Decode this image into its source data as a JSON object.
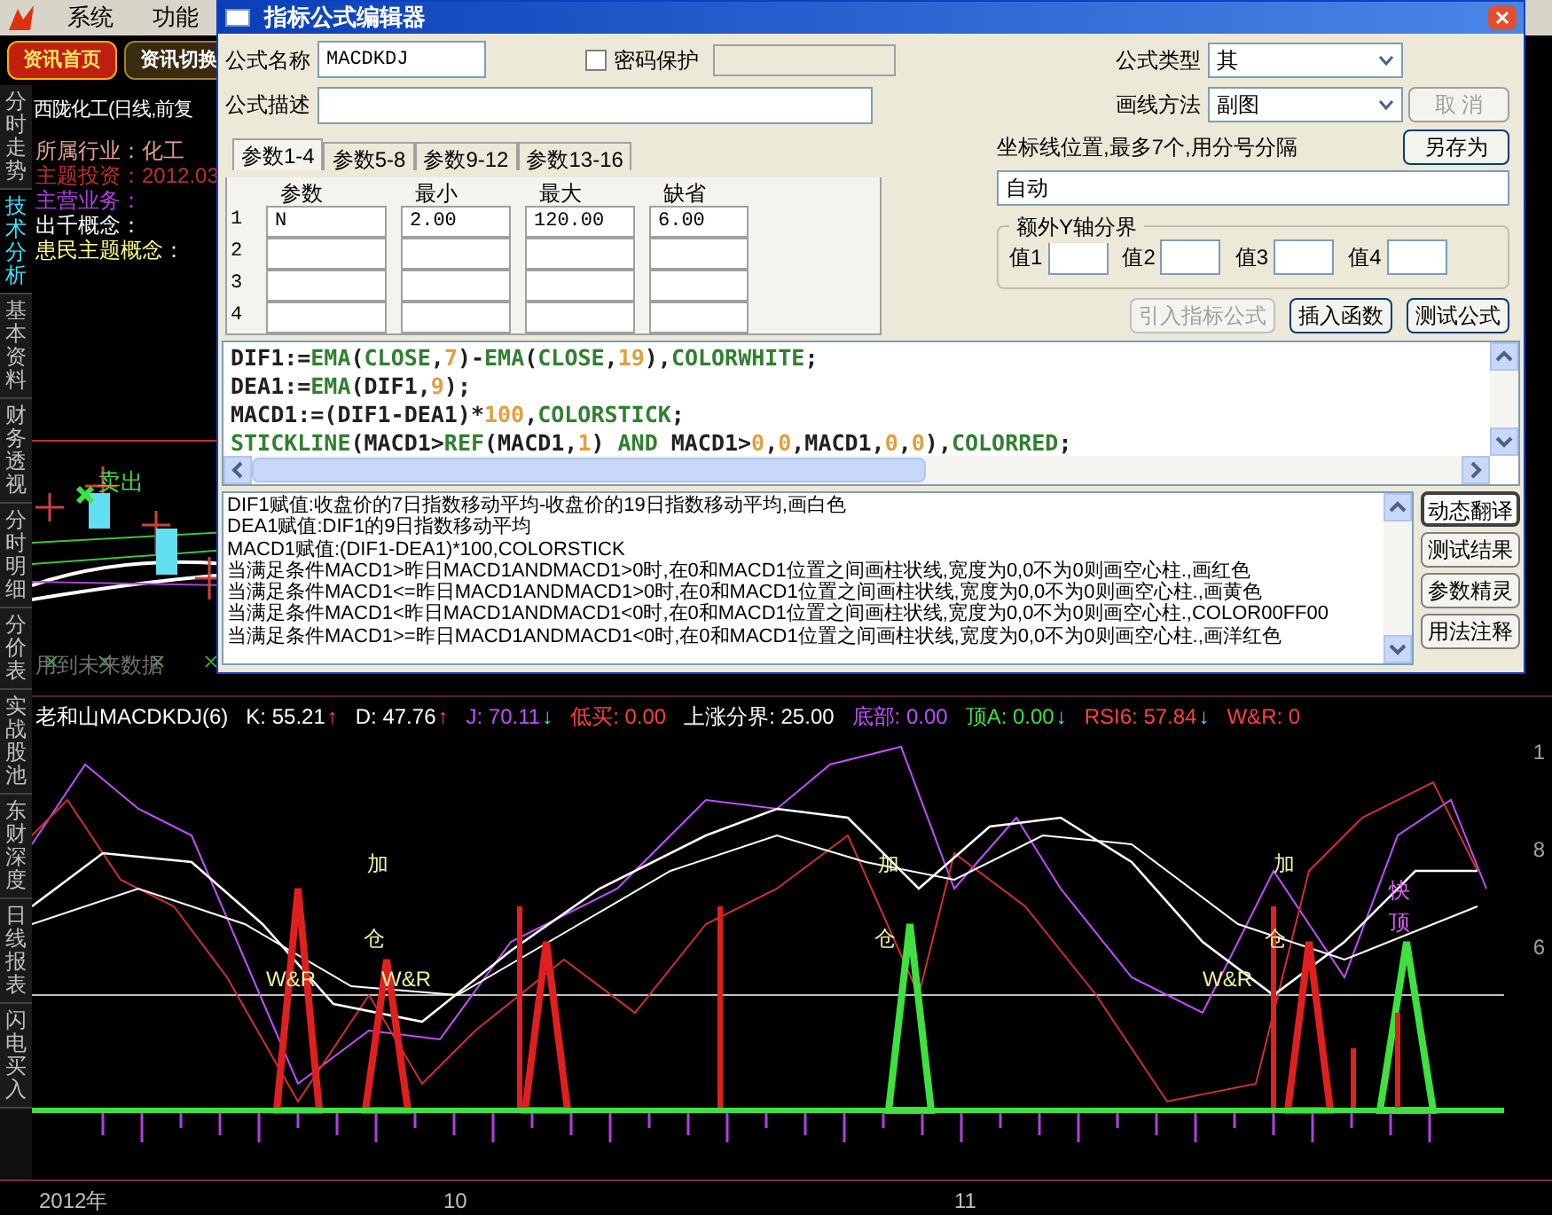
{
  "menu": {
    "items": [
      "系统",
      "功能"
    ]
  },
  "toolbar": [
    {
      "label": "资讯首页",
      "selected": true
    },
    {
      "label": "资讯切换",
      "selected": false
    }
  ],
  "side_tabs": [
    {
      "label": "分时走势",
      "selected": false
    },
    {
      "label": "技术分析",
      "selected": true
    },
    {
      "label": "基本资料",
      "selected": false
    },
    {
      "label": "财务透视",
      "selected": false
    },
    {
      "label": "分时明细",
      "selected": false
    },
    {
      "label": "分价表",
      "selected": false
    },
    {
      "label": "实战股池",
      "selected": false
    },
    {
      "label": "东财深度",
      "selected": false
    },
    {
      "label": "日线报表",
      "selected": false
    },
    {
      "label": "闪电买入",
      "selected": false
    }
  ],
  "stock": {
    "title": "西陇化工(日线,前复",
    "info": [
      {
        "text": "所属行业：化工",
        "color": "#e0a090"
      },
      {
        "text": "主题投资：2012.03",
        "color": "#c03030"
      },
      {
        "text": "主营业务：",
        "color": "#b040e0"
      },
      {
        "text": "出千概念：",
        "color": "#ffffff"
      },
      {
        "text": "患民主题概念：",
        "color": "#ffff80"
      }
    ]
  },
  "upper_chart": {
    "signal": "卖出",
    "note": "用到未来数据"
  },
  "indicator": {
    "name": "老和山MACDKDJ(6)",
    "values": [
      {
        "text": "K: 55.21",
        "color": "#ffffff",
        "kind": "rising",
        "arrow": "↑"
      },
      {
        "text": "D: 47.76",
        "color": "#ffffff",
        "kind": "rising",
        "arrow": "↑"
      },
      {
        "text": "J: 70.11",
        "color": "#c050ff",
        "kind": "falling",
        "arrow": "↓"
      },
      {
        "text": "低买: 0.00",
        "color": "#ff4040",
        "kind": "plain"
      },
      {
        "text": "上涨分界: 25.00",
        "color": "#ffffff",
        "kind": "plain"
      },
      {
        "text": "底部: 0.00",
        "color": "#c050ff",
        "kind": "plain"
      },
      {
        "text": "顶A: 0.00",
        "color": "#40e040",
        "kind": "falling",
        "arrow": "↓"
      },
      {
        "text": "RSI6: 57.84",
        "color": "#ff4040",
        "kind": "falling",
        "arrow": "↓"
      },
      {
        "text": "W&R: 0",
        "color": "#ff4040",
        "kind": "plain"
      }
    ],
    "labels": [
      "加",
      "加",
      "加",
      "仓",
      "仓",
      "仓",
      "W&R",
      "W&R",
      "W&R",
      "快",
      "顶"
    ],
    "axis_ticks": [
      "1",
      "8",
      "6"
    ]
  },
  "time_axis": [
    "2012年",
    "10",
    "11"
  ],
  "dialog": {
    "title": "指标公式编辑器",
    "name_label": "公式名称",
    "name_value": "MACDKDJ",
    "password": {
      "label": "密码保护",
      "checked": false
    },
    "desc_label": "公式描述",
    "param_tabs": [
      {
        "label": "参数1-4",
        "selected": true
      },
      {
        "label": "参数5-8",
        "selected": false
      },
      {
        "label": "参数9-12",
        "selected": false
      },
      {
        "label": "参数13-16",
        "selected": false
      }
    ],
    "param_headers": [
      "参数",
      "最小",
      "最大",
      "缺省"
    ],
    "params": [
      {
        "index": "1",
        "cells": [
          "N",
          "2.00",
          "120.00",
          "6.00"
        ]
      },
      {
        "index": "2"
      },
      {
        "index": "3"
      },
      {
        "index": "4"
      }
    ],
    "type_label": "公式类型",
    "type_value": "其",
    "draw_label": "画线方法",
    "draw_value": "副图",
    "cancel": "取 消",
    "axis_label": "坐标线位置,最多7个,用分号分隔",
    "axis_value": "自动",
    "save_as": "另存为",
    "y_group": "额外Y轴分界",
    "y_fields": [
      "值1",
      "值2",
      "值3",
      "值4"
    ],
    "actions": [
      {
        "label": "引入指标公式",
        "disabled": true
      },
      {
        "label": "插入函数",
        "disabled": false
      },
      {
        "label": "测试公式",
        "disabled": false
      }
    ],
    "code": [
      [
        {
          "t": "DIF1:=",
          "kind": "plain"
        },
        {
          "t": "EMA",
          "kind": "func"
        },
        {
          "t": "(",
          "kind": "plain"
        },
        {
          "t": "CLOSE",
          "kind": "func"
        },
        {
          "t": ",",
          "kind": "plain"
        },
        {
          "t": "7",
          "kind": "num"
        },
        {
          "t": ")-",
          "kind": "plain"
        },
        {
          "t": "EMA",
          "kind": "func"
        },
        {
          "t": "(",
          "kind": "plain"
        },
        {
          "t": "CLOSE",
          "kind": "func"
        },
        {
          "t": ",",
          "kind": "plain"
        },
        {
          "t": "19",
          "kind": "num"
        },
        {
          "t": "),",
          "kind": "plain"
        },
        {
          "t": "COLORWHITE",
          "kind": "func"
        },
        {
          "t": ";",
          "kind": "plain"
        }
      ],
      [
        {
          "t": "DEA1:=",
          "kind": "plain"
        },
        {
          "t": "EMA",
          "kind": "func"
        },
        {
          "t": "(DIF1,",
          "kind": "plain"
        },
        {
          "t": "9",
          "kind": "num"
        },
        {
          "t": ");",
          "kind": "plain"
        }
      ],
      [
        {
          "t": "MACD1:=(DIF1-DEA1)*",
          "kind": "plain"
        },
        {
          "t": "100",
          "kind": "num"
        },
        {
          "t": ",",
          "kind": "plain"
        },
        {
          "t": "COLORSTICK",
          "kind": "func"
        },
        {
          "t": ";",
          "kind": "plain"
        }
      ],
      [
        {
          "t": "STICKLINE",
          "kind": "func"
        },
        {
          "t": "(MACD1>",
          "kind": "plain"
        },
        {
          "t": "REF",
          "kind": "func"
        },
        {
          "t": "(MACD1,",
          "kind": "plain"
        },
        {
          "t": "1",
          "kind": "num"
        },
        {
          "t": ") ",
          "kind": "plain"
        },
        {
          "t": "AND",
          "kind": "func"
        },
        {
          "t": " MACD1>",
          "kind": "plain"
        },
        {
          "t": "0",
          "kind": "num"
        },
        {
          "t": ",",
          "kind": "plain"
        },
        {
          "t": "0",
          "kind": "num"
        },
        {
          "t": ",MACD1,",
          "kind": "plain"
        },
        {
          "t": "0",
          "kind": "num"
        },
        {
          "t": ",",
          "kind": "plain"
        },
        {
          "t": "0",
          "kind": "num"
        },
        {
          "t": "),",
          "kind": "plain"
        },
        {
          "t": "COLORRED",
          "kind": "func"
        },
        {
          "t": ";",
          "kind": "plain"
        }
      ]
    ],
    "description": [
      "DIF1赋值:收盘价的7日指数移动平均-收盘价的19日指数移动平均,画白色",
      "DEA1赋值:DIF1的9日指数移动平均",
      "MACD1赋值:(DIF1-DEA1)*100,COLORSTICK",
      "当满足条件MACD1>昨日MACD1ANDMACD1>0时,在0和MACD1位置之间画柱状线,宽度为0,0不为0则画空心柱.,画红色",
      "当满足条件MACD1<=昨日MACD1ANDMACD1>0时,在0和MACD1位置之间画柱状线,宽度为0,0不为0则画空心柱.,画黄色",
      "当满足条件MACD1<昨日MACD1ANDMACD1<0时,在0和MACD1位置之间画柱状线,宽度为0,0不为0则画空心柱.,COLOR00FF00",
      "当满足条件MACD1>=昨日MACD1ANDMACD1<0时,在0和MACD1位置之间画柱状线,宽度为0,0不为0则画空心柱.,画洋红色"
    ],
    "side_buttons": [
      {
        "label": "动态翻译",
        "selected": true
      },
      {
        "label": "测试结果",
        "selected": false
      },
      {
        "label": "参数精灵",
        "selected": false
      },
      {
        "label": "用法注释",
        "selected": false
      }
    ]
  }
}
